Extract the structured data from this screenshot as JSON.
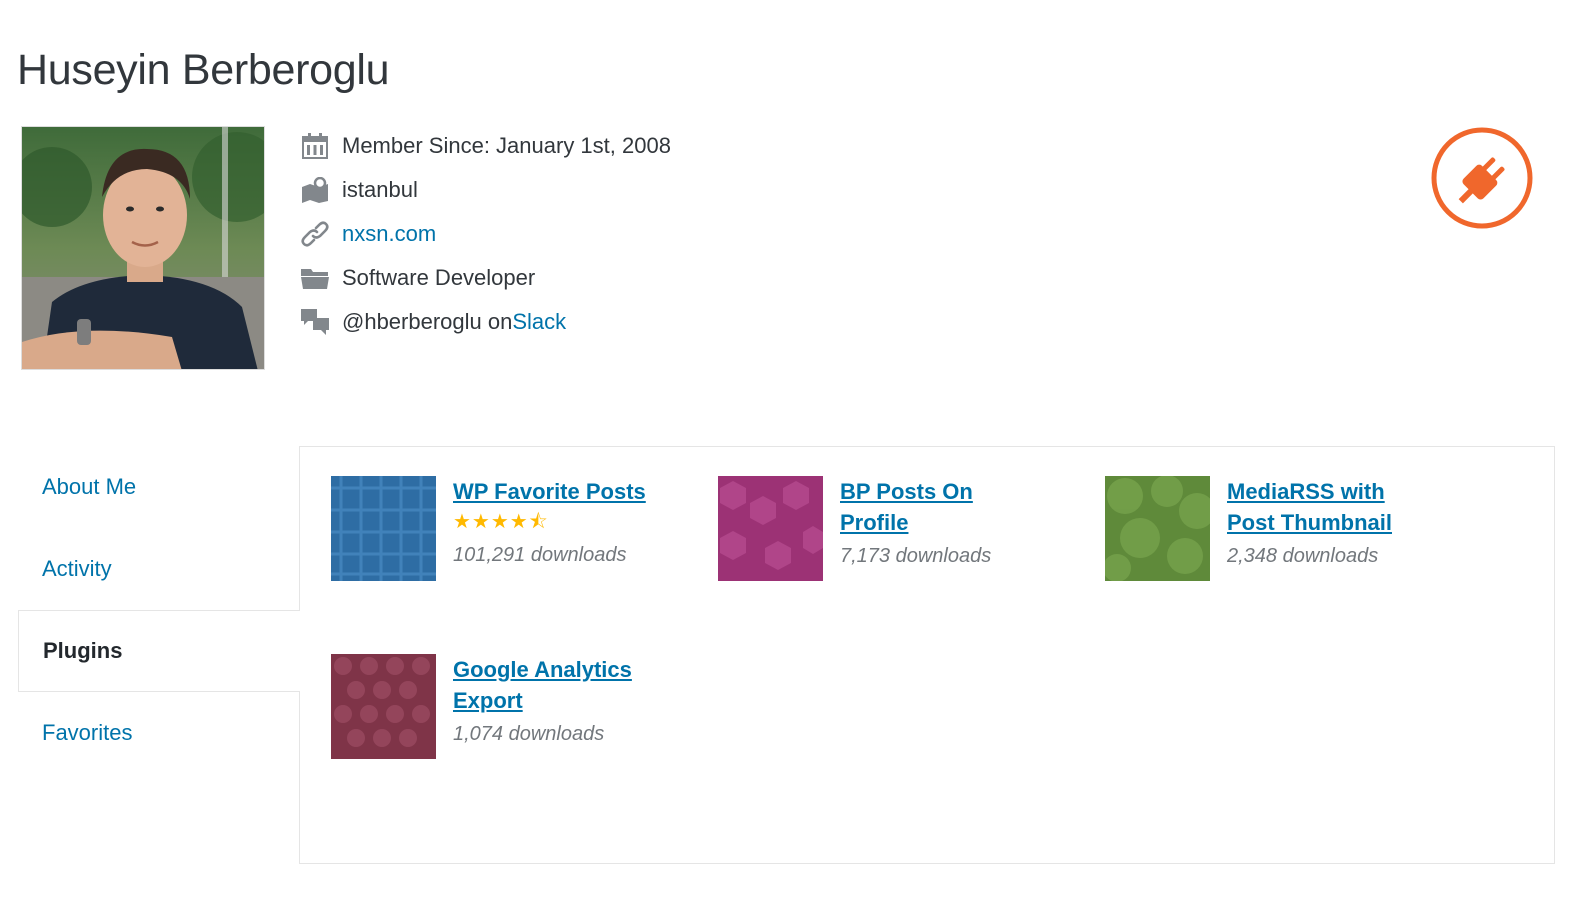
{
  "profile": {
    "name": "Huseyin Berberoglu",
    "member_since": "Member Since: January 1st, 2008",
    "location": "istanbul",
    "website": "nxsn.com",
    "job": "Software Developer",
    "slack_handle": "@hberberoglu on ",
    "slack_link": "Slack"
  },
  "tabs": [
    {
      "label": "About Me",
      "active": false
    },
    {
      "label": "Activity",
      "active": false
    },
    {
      "label": "Plugins",
      "active": true
    },
    {
      "label": "Favorites",
      "active": false
    }
  ],
  "plugins": [
    {
      "title": "WP Favorite Posts",
      "rating": 4.5,
      "stars": "★★★★⯪",
      "downloads": "101,291 downloads",
      "color": "#2e6da4"
    },
    {
      "title": "BP Posts On Profile",
      "downloads": "7,173 downloads",
      "color": "#9c3275"
    },
    {
      "title": "MediaRSS with Post Thumbnail",
      "downloads": "2,348 downloads",
      "color": "#5f8a3a"
    },
    {
      "title": "Google Analytics Export",
      "downloads": "1,074 downloads",
      "color": "#7f3448"
    }
  ],
  "colors": {
    "link": "#0073aa",
    "badge": "#f0672c",
    "star": "#ffb900"
  },
  "icons": {
    "member_since": "calendar-icon",
    "location": "location-map-icon",
    "website": "link-icon",
    "job": "folder-icon",
    "slack": "chat-bubbles-icon",
    "badge": "plugin-developer-badge-icon"
  }
}
